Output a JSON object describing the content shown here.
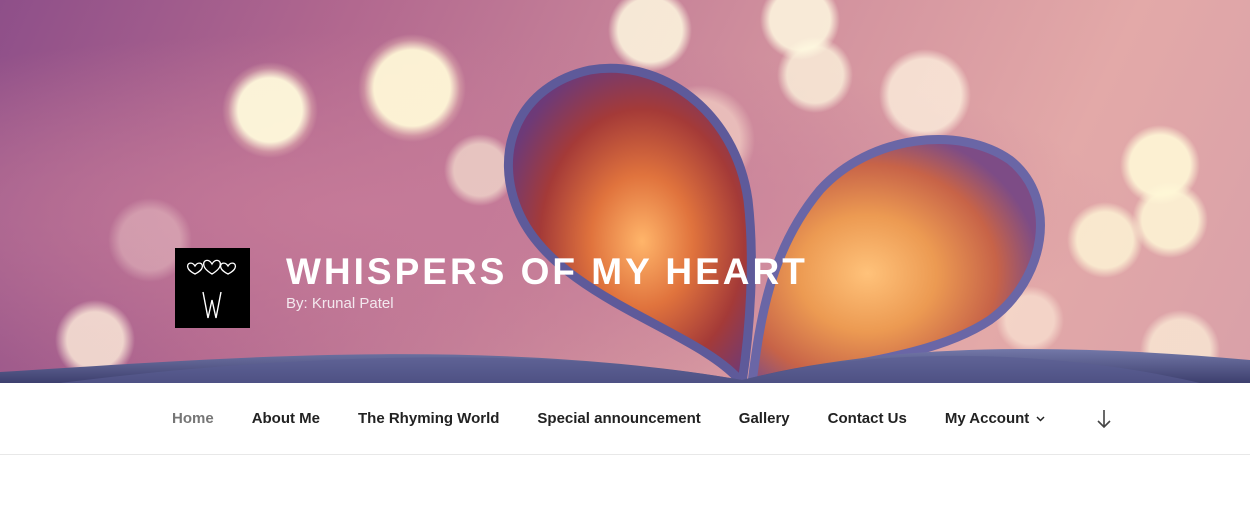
{
  "site": {
    "title": "WHISPERS OF MY HEART",
    "description": "By: Krunal Patel",
    "logo": {
      "glyph_hearts": "♡♡♡",
      "glyph_letter": "W"
    }
  },
  "nav": {
    "items": [
      {
        "label": "Home",
        "current": true
      },
      {
        "label": "About Me"
      },
      {
        "label": "The Rhyming World"
      },
      {
        "label": "Special announcement"
      },
      {
        "label": "Gallery"
      },
      {
        "label": "Contact Us"
      },
      {
        "label": "My Account",
        "has_submenu": true
      }
    ],
    "submenu_icon": "chevron-down-icon",
    "scroll_icon": "arrow-down-icon"
  },
  "colors": {
    "menu_text": "#222222",
    "menu_current": "#767676",
    "title": "#ffffff"
  }
}
